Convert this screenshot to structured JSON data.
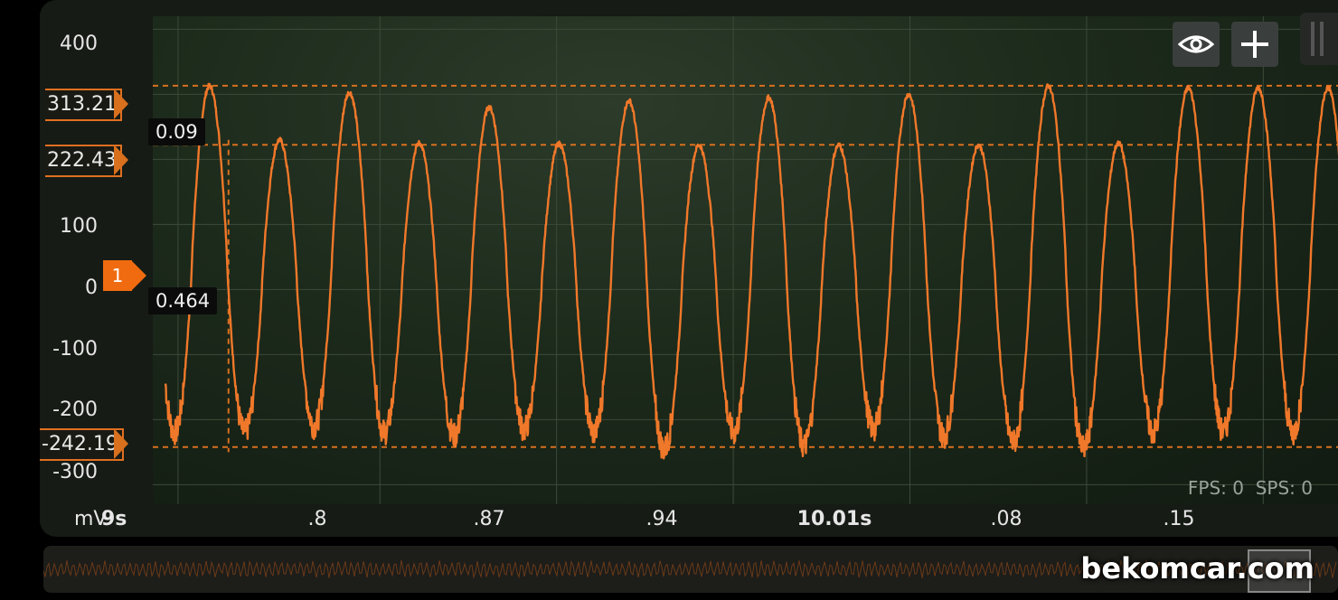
{
  "chart_data": {
    "type": "line",
    "series": [
      {
        "peaks": [
          313,
          230,
          303,
          225,
          280,
          224,
          290,
          222,
          295,
          222,
          300,
          222,
          313,
          225,
          310
        ],
        "troughs": [
          -220,
          -210,
          -220,
          -225,
          -215,
          -220,
          -245,
          -220,
          -240,
          -215,
          -225,
          -235,
          -245,
          -220
        ]
      }
    ],
    "ylim": [
      -330,
      420
    ],
    "xlim": [
      9.71,
      10.19
    ],
    "y_ticks": [
      "400",
      "100",
      "0",
      "-100",
      "-200",
      "-300"
    ],
    "x_ticks": [
      {
        "label": "9s",
        "value": 9.72
      },
      {
        "label": ".8",
        "value": 9.8
      },
      {
        "label": ".87",
        "value": 9.87
      },
      {
        "label": ".94",
        "value": 9.94
      },
      {
        "label": "10.01s",
        "value": 10.01
      },
      {
        "label": ".08",
        "value": 10.08
      },
      {
        "label": ".15",
        "value": 10.15
      }
    ],
    "cursors": {
      "horizontal": [
        "313.21",
        "222.43",
        "-242.19"
      ],
      "vertical_x": 9.74
    },
    "y_unit": "mV",
    "colors": {
      "trace": "#f0782a",
      "cursor": "#d8701e",
      "grid": "#3c4a3a"
    }
  },
  "labels": {
    "unit": "mV",
    "x_first": "9s",
    "readout_time": "0.09",
    "readout_value": "0.464",
    "channel": "1",
    "fps": "FPS: 0",
    "sps": "SPS: 0",
    "watermark": "bekomcar.com"
  },
  "toolbar": {
    "icons": [
      "eye-icon",
      "plus-icon"
    ]
  }
}
